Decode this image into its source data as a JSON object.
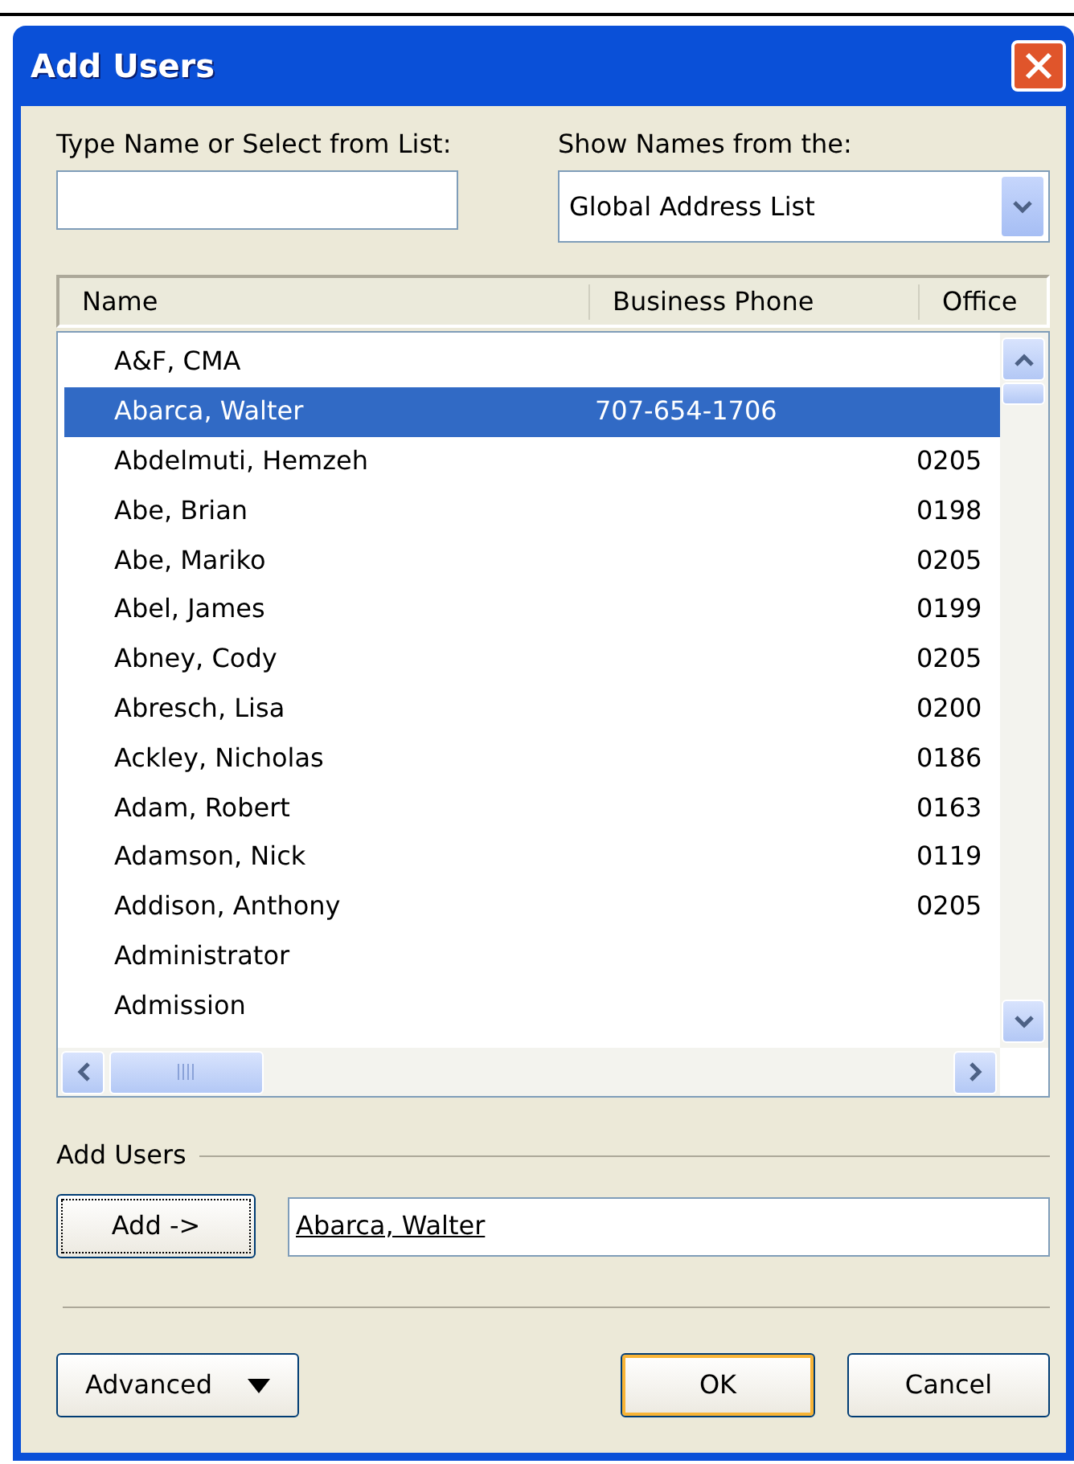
{
  "window": {
    "title": "Add Users"
  },
  "search": {
    "label": "Type Name or Select from List:"
  },
  "address_book": {
    "label": "Show Names from the:",
    "value": "Global Address List"
  },
  "table": {
    "columns": [
      "Name",
      "Business Phone",
      "Office"
    ],
    "rows": [
      {
        "name": "A&F, CMA",
        "selected": false
      },
      {
        "name": "Abarca, Walter",
        "phone": "707-654-1706",
        "selected": true
      },
      {
        "name": "Abdelmuti, Hemzeh",
        "office": "0205",
        "selected": false
      },
      {
        "name": "Abe, Brian",
        "office": "0198",
        "selected": false
      },
      {
        "name": "Abe, Mariko",
        "office": "0205",
        "selected": false
      },
      {
        "name": "Abel, James",
        "office": "0199",
        "selected": false
      },
      {
        "name": "Abney, Cody",
        "office": "0205",
        "selected": false
      },
      {
        "name": "Abresch, Lisa",
        "office": "0200",
        "selected": false
      },
      {
        "name": "Ackley, Nicholas",
        "office": "0186",
        "selected": false
      },
      {
        "name": "Adam, Robert",
        "office": "0163",
        "selected": false
      },
      {
        "name": "Adamson, Nick",
        "office": "0119",
        "selected": false
      },
      {
        "name": "Addison, Anthony",
        "office": "0205",
        "selected": false
      },
      {
        "name": "Administrator",
        "selected": false
      },
      {
        "name": "Admission",
        "selected": false
      }
    ]
  },
  "add_users": {
    "label": "Add Users",
    "button": "Add ->",
    "value": "Abarca, Walter",
    "underlined": true
  },
  "buttons": [
    {
      "kind": "menu",
      "label": "Advanced",
      "default": false
    },
    {
      "kind": "plain",
      "label": "OK",
      "default": true
    },
    {
      "kind": "plain",
      "label": "Cancel",
      "default": false
    }
  ]
}
